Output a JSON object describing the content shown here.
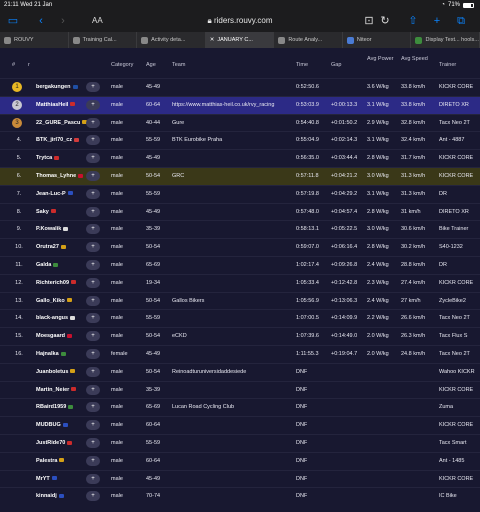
{
  "status": {
    "time": "21:11",
    "date": "Wed 21 Jan",
    "battery": "71%"
  },
  "browser": {
    "aa_label": "AA",
    "url": "riders.rouvy.com",
    "tabs": [
      {
        "label": "ROUVY"
      },
      {
        "label": "Training Cal..."
      },
      {
        "label": "Activity deta..."
      },
      {
        "label": "JANUARY C..."
      },
      {
        "label": "Route Analy..."
      },
      {
        "label": "Niteor"
      },
      {
        "label": "Display Text... hools..."
      }
    ]
  },
  "table": {
    "headers": {
      "rank": "#",
      "rider": "r",
      "category": "Category",
      "age": "Age",
      "team": "Team",
      "time": "Time",
      "gap": "Gap",
      "power": "Avg Power",
      "speed": "Avg Speed",
      "trainer": "Trainer"
    },
    "rows": [
      {
        "rank": "1",
        "name": "bergakungen",
        "category": "male",
        "age": "45-49",
        "team": "",
        "time": "0:52:50.6",
        "gap": "",
        "power": "3.6 W/kg",
        "speed": "33.8 km/h",
        "trainer": "KICKR CORE",
        "flag": "#1f4fa5"
      },
      {
        "rank": "2",
        "name": "MatthiasHeil",
        "category": "male",
        "age": "60-64",
        "team": "https://www.matthias-heil.co.uk/rvy_racing",
        "time": "0:53:03.9",
        "gap": "+0:00:13.3",
        "power": "3.1 W/kg",
        "speed": "33.8 km/h",
        "trainer": "DIRETO XR",
        "flag": "#cc2b2b"
      },
      {
        "rank": "3",
        "name": "22_GURE_Pascu",
        "category": "male",
        "age": "40-44",
        "team": "Gure",
        "time": "0:54:40.8",
        "gap": "+0:01:50.2",
        "power": "2.9 W/kg",
        "speed": "32.8 km/h",
        "trainer": "Tacx Neo 2T",
        "flag": "#d4a017"
      },
      {
        "rank": "4.",
        "name": "BTK_jirl70_cz",
        "category": "male",
        "age": "55-59",
        "team": "BTK Eurobike Praha",
        "time": "0:55:04.9",
        "gap": "+0:02:14.3",
        "power": "3.1 W/kg",
        "speed": "32.4 km/h",
        "trainer": "Ant - 4887",
        "flag": "#d33b3b"
      },
      {
        "rank": "5.",
        "name": "Trytca",
        "category": "male",
        "age": "45-49",
        "team": "",
        "time": "0:56:35.0",
        "gap": "+0:03:44.4",
        "power": "2.8 W/kg",
        "speed": "31.7 km/h",
        "trainer": "KICKR CORE",
        "flag": "#cc2b2b"
      },
      {
        "rank": "6.",
        "name": "Thomas_Lyhne",
        "category": "male",
        "age": "50-54",
        "team": "GRC",
        "time": "0:57:11.8",
        "gap": "+0:04:21.2",
        "power": "3.0 W/kg",
        "speed": "31.3 km/h",
        "trainer": "KICKR CORE",
        "flag": "#c8102e"
      },
      {
        "rank": "7.",
        "name": "Jean-Luc-P",
        "category": "male",
        "age": "55-59",
        "team": "",
        "time": "0:57:19.8",
        "gap": "+0:04:29.2",
        "power": "3.1 W/kg",
        "speed": "31.3 km/h",
        "trainer": "DR",
        "flag": "#2b4fbf"
      },
      {
        "rank": "8.",
        "name": "Saky",
        "category": "male",
        "age": "45-49",
        "team": "",
        "time": "0:57:48.0",
        "gap": "+0:04:57.4",
        "power": "2.8 W/kg",
        "speed": "31 km/h",
        "trainer": "DIRETO XR",
        "flag": "#cc2b2b"
      },
      {
        "rank": "9.",
        "name": "P.Kowalik",
        "category": "male",
        "age": "35-39",
        "team": "",
        "time": "0:58:13.1",
        "gap": "+0:05:22.5",
        "power": "3.0 W/kg",
        "speed": "30.6 km/h",
        "trainer": "Bike Trainer",
        "flag": "#dcdcdc"
      },
      {
        "rank": "10.",
        "name": "Orutra27",
        "category": "male",
        "age": "50-54",
        "team": "",
        "time": "0:59:07.0",
        "gap": "+0:06:16.4",
        "power": "2.8 W/kg",
        "speed": "30.2 km/h",
        "trainer": "S40-1232",
        "flag": "#d4a017"
      },
      {
        "rank": "11.",
        "name": "Galda",
        "category": "male",
        "age": "65-69",
        "team": "",
        "time": "1:02:17.4",
        "gap": "+0:09:26.8",
        "power": "2.4 W/kg",
        "speed": "28.8 km/h",
        "trainer": "DR",
        "flag": "#3d8c3d"
      },
      {
        "rank": "12.",
        "name": "Richterich09",
        "category": "male",
        "age": "19-34",
        "team": "",
        "time": "1:05:33.4",
        "gap": "+0:12:42.8",
        "power": "2.3 W/kg",
        "speed": "27.4 km/h",
        "trainer": "KICKR CORE",
        "flag": "#cc2b2b"
      },
      {
        "rank": "13.",
        "name": "Gallo_Kiko",
        "category": "male",
        "age": "50-54",
        "team": "Gallos Bikers",
        "time": "1:05:56.9",
        "gap": "+0:13:06.3",
        "power": "2.4 W/kg",
        "speed": "27 km/h",
        "trainer": "ZycleBike2",
        "flag": "#d4a017"
      },
      {
        "rank": "14.",
        "name": "black-angus",
        "category": "male",
        "age": "55-59",
        "team": "",
        "time": "1:07:00.5",
        "gap": "+0:14:09.9",
        "power": "2.2 W/kg",
        "speed": "26.6 km/h",
        "trainer": "Tacx Neo 2T",
        "flag": "#dcdcdc"
      },
      {
        "rank": "15.",
        "name": "Moesgaard",
        "category": "male",
        "age": "50-54",
        "team": "eCKD",
        "time": "1:07:39.6",
        "gap": "+0:14:49.0",
        "power": "2.0 W/kg",
        "speed": "26.3 km/h",
        "trainer": "Tacx Flux S",
        "flag": "#c8102e"
      },
      {
        "rank": "16.",
        "name": "Hajnalka",
        "category": "female",
        "age": "45-49",
        "team": "",
        "time": "1:11:55.3",
        "gap": "+0:19:04.7",
        "power": "2.0 W/kg",
        "speed": "24.8 km/h",
        "trainer": "Tacx Neo 2T",
        "flag": "#3d8c3d"
      },
      {
        "rank": "",
        "name": "Juanboletus",
        "category": "male",
        "age": "50-54",
        "team": "Reinoadturuniversidaddesiede",
        "time": "DNF",
        "gap": "",
        "power": "",
        "speed": "",
        "trainer": "Wahoo KICKR",
        "flag": "#d4a017"
      },
      {
        "rank": "",
        "name": "Martin_Neier",
        "category": "male",
        "age": "35-39",
        "team": "",
        "time": "DNF",
        "gap": "",
        "power": "",
        "speed": "",
        "trainer": "KICKR CORE",
        "flag": "#cc2b2b"
      },
      {
        "rank": "",
        "name": "RBaird1959",
        "category": "male",
        "age": "65-69",
        "team": "Lucan Road Cycling Club",
        "time": "DNF",
        "gap": "",
        "power": "",
        "speed": "",
        "trainer": "Zuma",
        "flag": "#3d8c3d"
      },
      {
        "rank": "",
        "name": "MUDBUG",
        "category": "male",
        "age": "60-64",
        "team": "",
        "time": "DNF",
        "gap": "",
        "power": "",
        "speed": "",
        "trainer": "KICKR CORE",
        "flag": "#2b4fbf"
      },
      {
        "rank": "",
        "name": "JustRide70",
        "category": "male",
        "age": "55-59",
        "team": "",
        "time": "DNF",
        "gap": "",
        "power": "",
        "speed": "",
        "trainer": "Tacx Smart",
        "flag": "#cc2b2b"
      },
      {
        "rank": "",
        "name": "Palestra",
        "category": "male",
        "age": "60-64",
        "team": "",
        "time": "DNF",
        "gap": "",
        "power": "",
        "speed": "",
        "trainer": "Ant - 1485",
        "flag": "#d4a017"
      },
      {
        "rank": "",
        "name": "MrYT",
        "category": "male",
        "age": "45-49",
        "team": "",
        "time": "DNF",
        "gap": "",
        "power": "",
        "speed": "",
        "trainer": "KICKR CORE",
        "flag": "#2b4fbf"
      },
      {
        "rank": "",
        "name": "kinnaidj",
        "category": "male",
        "age": "70-74",
        "team": "",
        "time": "DNF",
        "gap": "",
        "power": "",
        "speed": "",
        "trainer": "IC Bike",
        "flag": "#2b4fbf"
      }
    ]
  },
  "colors": {
    "bg": "#181830",
    "highlight_purple": "#2c2a86",
    "highlight_yellow": "#3a3818",
    "accent": "#0a84ff"
  }
}
